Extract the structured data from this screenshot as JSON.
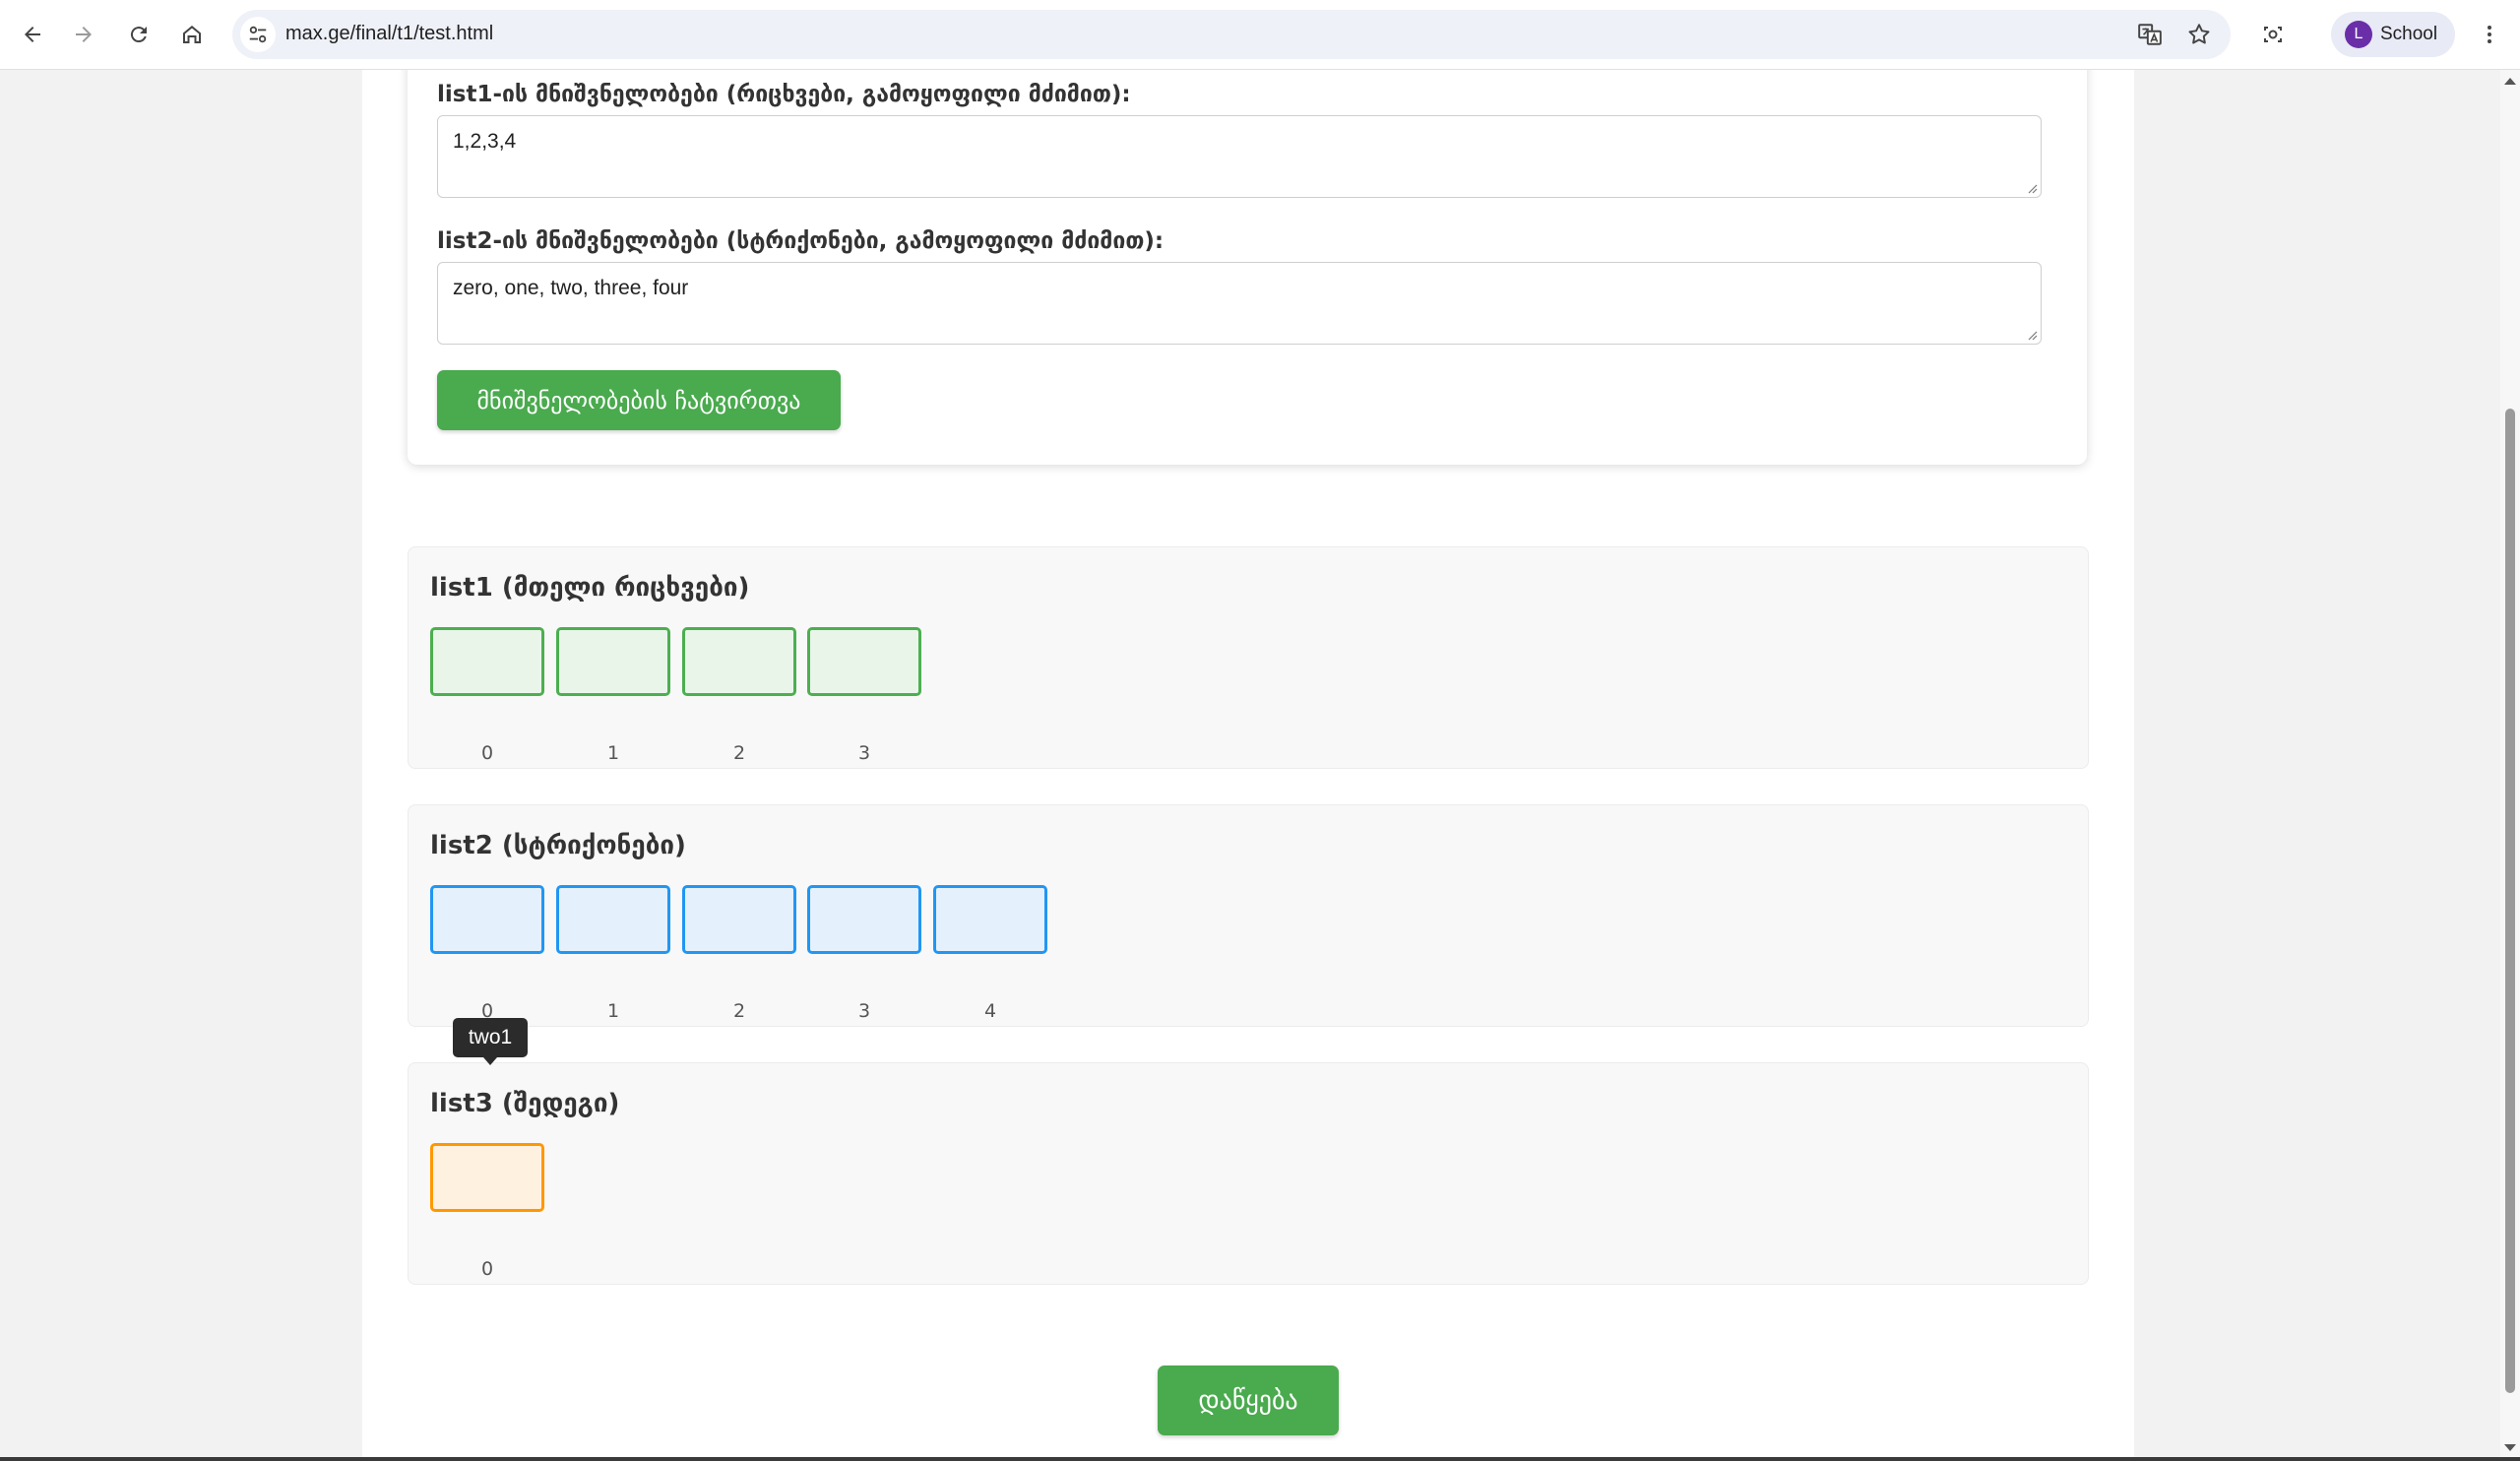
{
  "browser": {
    "url": "max.ge/final/t1/test.html",
    "profile_initial": "L",
    "profile_name": "School",
    "icons": [
      "back-icon",
      "forward-icon",
      "reload-icon",
      "home-icon",
      "site-info-icon",
      "translate-icon",
      "star-icon",
      "screenshot-icon",
      "more-menu-icon"
    ]
  },
  "form": {
    "list1_label": "list1-ის მნიშვნელობები (რიცხვები, გამოყოფილი მძიმით):",
    "list1_value": "1,2,3,4",
    "list2_label": "list2-ის მნიშვნელობები (სტრიქონები, გამოყოფილი მძიმით):",
    "list2_value": "zero, one, two, three, four",
    "load_button": "მნიშვნელობების ჩატვირთვა"
  },
  "lists": [
    {
      "title": "list1 (მთელი რიცხვები)",
      "color": "#4caf50",
      "indices": [
        "0",
        "1",
        "2",
        "3"
      ]
    },
    {
      "title": "list2 (სტრიქონები)",
      "color": "#2196f3",
      "indices": [
        "0",
        "1",
        "2",
        "3",
        "4"
      ]
    },
    {
      "title": "list3 (შედეგი)",
      "color": "#ff9800",
      "indices": [
        "0"
      ]
    }
  ],
  "tooltip": "two1",
  "start_button": "დაწყება",
  "colors": {
    "accent_green": "#4aaa4e",
    "profile": "#6a2fa8"
  }
}
